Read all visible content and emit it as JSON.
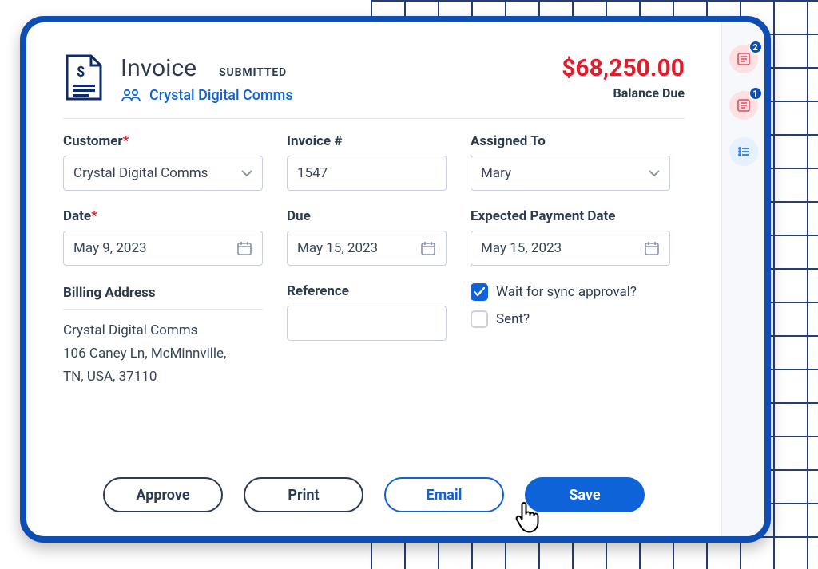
{
  "header": {
    "title": "Invoice",
    "status": "SUBMITTED",
    "customer_link": "Crystal Digital Comms",
    "amount": "$68,250.00",
    "balance_label": "Balance Due"
  },
  "fields": {
    "customer": {
      "label": "Customer",
      "value": "Crystal Digital Comms"
    },
    "invoice_no": {
      "label": "Invoice #",
      "value": "1547"
    },
    "assigned_to": {
      "label": "Assigned To",
      "value": "Mary"
    },
    "date": {
      "label": "Date",
      "value": "May 9, 2023"
    },
    "due": {
      "label": "Due",
      "value": "May 15, 2023"
    },
    "expected": {
      "label": "Expected Payment Date",
      "value": "May 15, 2023"
    },
    "billing_address": {
      "label": "Billing Address",
      "name": "Crystal Digital Comms",
      "line2": "106 Caney Ln, McMinnville,",
      "line3": "TN, USA, 37110"
    },
    "reference": {
      "label": "Reference",
      "value": ""
    },
    "wait_sync": {
      "label": "Wait for sync approval?",
      "checked": true
    },
    "sent": {
      "label": "Sent?",
      "checked": false
    }
  },
  "actions": {
    "approve": "Approve",
    "print": "Print",
    "email": "Email",
    "save": "Save"
  },
  "rail": {
    "chip1_badge": "2",
    "chip2_badge": "1"
  }
}
